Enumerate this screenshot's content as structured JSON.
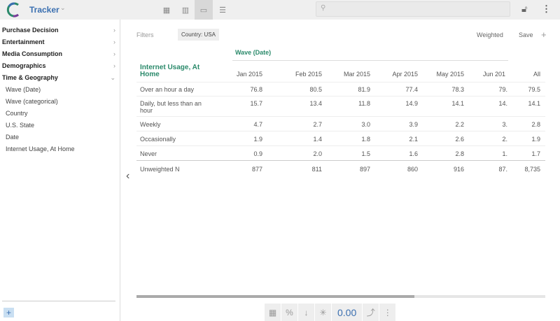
{
  "header": {
    "app_name": "Tracker",
    "search_placeholder": ""
  },
  "sidebar": {
    "items": [
      {
        "label": "Purchase Decision",
        "expanded": false
      },
      {
        "label": "Entertainment",
        "expanded": false
      },
      {
        "label": "Media Consumption",
        "expanded": false
      },
      {
        "label": "Demographics",
        "expanded": false
      },
      {
        "label": "Time & Geography",
        "expanded": true
      }
    ],
    "subitems": [
      "Wave (Date)",
      "Wave (categorical)",
      "Country",
      "U.S. State",
      "Date",
      "Internet Usage, At Home"
    ],
    "add_label": "+"
  },
  "toolbar": {
    "filters_label": "Filters",
    "filter_chip": "Country: USA",
    "weighted_label": "Weighted",
    "save_label": "Save",
    "add_label": "+"
  },
  "table": {
    "column_group": "Wave (Date)",
    "row_header": "Internet Usage, At Home",
    "columns": [
      "Jan 2015",
      "Feb 2015",
      "Mar 2015",
      "Apr 2015",
      "May 2015",
      "Jun 201",
      "All"
    ],
    "rows": [
      {
        "label": "Over an hour a day",
        "values": [
          "76.8",
          "80.5",
          "81.9",
          "77.4",
          "78.3",
          "79.",
          "79.5"
        ]
      },
      {
        "label": "Daily, but less than an hour",
        "values": [
          "15.7",
          "13.4",
          "11.8",
          "14.9",
          "14.1",
          "14.",
          "14.1"
        ]
      },
      {
        "label": "Weekly",
        "values": [
          "4.7",
          "2.7",
          "3.0",
          "3.9",
          "2.2",
          "3.",
          "2.8"
        ]
      },
      {
        "label": "Occasionally",
        "values": [
          "1.9",
          "1.4",
          "1.8",
          "2.1",
          "2.6",
          "2.",
          "1.9"
        ]
      },
      {
        "label": "Never",
        "values": [
          "0.9",
          "2.0",
          "1.5",
          "1.6",
          "2.8",
          "1.",
          "1.7"
        ]
      },
      {
        "label": "Unweighted N",
        "values": [
          "877",
          "811",
          "897",
          "860",
          "916",
          "87.",
          "8,735"
        ]
      }
    ]
  },
  "scroll_position_percent": 68,
  "bottom_bar": {
    "decimals": "0.00"
  },
  "colors": {
    "accent": "#2b8a6b",
    "brand": "#3a6fb0"
  }
}
